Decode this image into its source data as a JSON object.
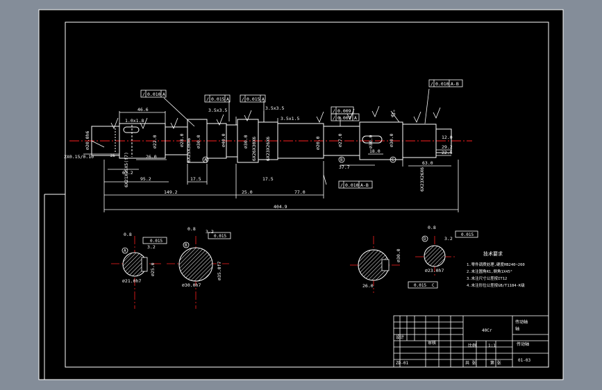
{
  "colors": {
    "viewport_bg": "#848d99",
    "paper": "#000000",
    "line": "#ffffff",
    "center": "#ff2020",
    "hatch": "#ffffff"
  },
  "upper_dims": {
    "d_466": "46.6",
    "d_10x18": "1.0x1.8",
    "d_35x35a": "3.5x3.5",
    "d_35x35b": "3.5x3.5",
    "d_35x15": "3.5x1.5",
    "d_45": "45°"
  },
  "lower_dims": {
    "d_16": "16",
    "d_260": "26.0",
    "d_672": "67.2",
    "d_952": "95.2",
    "d_175a": "17.5",
    "d_1492": "149.2",
    "d_250": "25.0",
    "d_175b": "17.5",
    "d_770": "77.0",
    "d_4049": "404.9",
    "d_377": "37.7",
    "d_180": "18.0",
    "d_630": "63.0",
    "d_225": "22.5",
    "d_292": "29.2",
    "d_120": "12.0"
  },
  "diameters": {
    "o1": "⌀20.0h6",
    "o2": "⌀22.0",
    "o3": "⌀28.0",
    "o4": "⌀30.0",
    "o5": "⌀40.0",
    "o6": "⌀30.0",
    "o7": "⌀27.0",
    "o8": "⌀20.0",
    "o9": "⌀30.0",
    "o10": "⌀30.0"
  },
  "vertical_callouts": {
    "v1": "6X21X25X5(f7)",
    "v2": "6X25X30X6",
    "v3": "6X26X30X6",
    "v4": "6X23X26X6",
    "v5": "6X23X26X6",
    "thread": "2X0.15/0.10"
  },
  "tolerances": {
    "t1_sym": "/",
    "t1_val": "0.010",
    "t1_ref": "A",
    "t2_sym": "/",
    "t2_val": "0.015",
    "t2_ref": "A",
    "t3_sym": "/",
    "t3_val": "0.015",
    "t3_ref": "A",
    "t4_sym": "/",
    "t4_val": "0.009",
    "t5_sym": "/",
    "t5_val": "0.007",
    "t5_ref": "A",
    "t6_sym": "/",
    "t6_val": "0.010",
    "t6_ref": "A-B",
    "t7_sym": "/",
    "t7_val": "0.010",
    "t7_ref": "A-B"
  },
  "datum_labels": {
    "a": "A",
    "b": "B",
    "c": "C"
  },
  "sections": {
    "A": {
      "label": "A",
      "roughness": "0.8",
      "r2": "3.2",
      "sym_val": "0.015",
      "dim_w": "⌀21.0h7",
      "dim_h": "⌀25.0"
    },
    "B": {
      "label": "B",
      "roughness": "0.8",
      "r2": "3.2",
      "sym_val": "0.015",
      "dim_w": "⌀30.0h7",
      "dim_h": "⌀35.0f7"
    },
    "C": {
      "dim_w": "26.0",
      "dim_h": "⌀30.0",
      "sym_val": "0.015",
      "ref": "C"
    },
    "D": {
      "label": "D",
      "roughness": "0.8",
      "r2": "3.2",
      "sym_val": "0.015",
      "dim_w": "⌀23.0h7"
    }
  },
  "notes": {
    "title": "技术要求",
    "lines": [
      "1.零件调质处理,硬度HB240~260",
      "2.未注圆角R1,倒角1X45°",
      "3.未注尺寸公差按IT12",
      "4.未注形位公差按GB/T1184-K级"
    ]
  },
  "title_block": {
    "drawing_name": "传动轴",
    "material": "40Cr",
    "scale": "1:1",
    "label1": "轴",
    "label2": "传动轴",
    "code1": "ZD-01",
    "code2": "比例",
    "code3": "设计",
    "code4": "审核",
    "code5": "共 张",
    "code6": "第 张",
    "code7": "01-03"
  }
}
